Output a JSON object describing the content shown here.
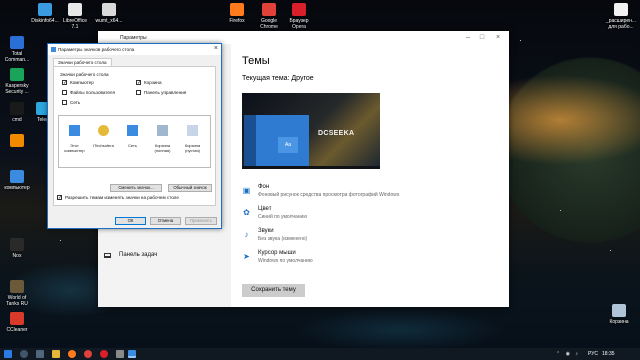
{
  "desktop": {
    "icons": [
      {
        "label": "Diskinfo64...",
        "icon": "diskinfo-icon",
        "color": "#3b9be0"
      },
      {
        "label": "LibreOffice\n7.1",
        "icon": "libreoffice-icon",
        "color": "#e8e8e8"
      },
      {
        "label": "wumt_x64...",
        "icon": "wumt-icon",
        "color": "#d9d9d9"
      },
      {
        "label": "Firefox",
        "icon": "firefox-icon",
        "color": "#ff7b1c"
      },
      {
        "label": "Google\nChrome",
        "icon": "chrome-icon",
        "color": "#e0423a"
      },
      {
        "label": "Браузер\nOpera",
        "icon": "opera-icon",
        "color": "#d81f2a"
      },
      {
        "label": "_расширен...\nдля рабо...",
        "icon": "document-icon",
        "color": "#f2f2f2"
      },
      {
        "label": "Total\nComman...",
        "icon": "total-commander-icon",
        "color": "#2a6fd6"
      },
      {
        "label": "Kaspersky\nSecurity ...",
        "icon": "kaspersky-icon",
        "color": "#1aa35a"
      },
      {
        "label": "cmd",
        "icon": "cmd-icon",
        "color": "#1a1a1a"
      },
      {
        "label": "Teleg",
        "icon": "telegram-icon",
        "color": "#2ea6de"
      },
      {
        "label": "",
        "icon": "vlc-icon",
        "color": "#f08a00"
      },
      {
        "label": "компьютер",
        "icon": "computer-icon",
        "color": "#3b8be0"
      },
      {
        "label": "Nox",
        "icon": "nox-icon",
        "color": "#2a2a2a"
      },
      {
        "label": "World of\nTanks RU",
        "icon": "world-of-tanks-icon",
        "color": "#6b5a3a"
      },
      {
        "label": "CCleaner",
        "icon": "ccleaner-icon",
        "color": "#d93a2a"
      },
      {
        "label": "Корзина",
        "icon": "recycle-bin-icon",
        "color": "#b0c4d8"
      }
    ]
  },
  "settings_window": {
    "title": "Параметры",
    "heading": "Темы",
    "current_theme": "Текущая тема: Другое",
    "preview_watermark": "DCSEEKA",
    "preview_tile": "Aa",
    "nav_taskbar": "Панель задач",
    "options": [
      {
        "title": "Фон",
        "subtitle": "Фоновый рисунок средства просмотра фотографий Windows",
        "icon": "background-icon"
      },
      {
        "title": "Цвет",
        "subtitle": "Синий по умолчанию",
        "icon": "palette-icon"
      },
      {
        "title": "Звуки",
        "subtitle": "Без звука (изменено)",
        "icon": "sound-icon"
      },
      {
        "title": "Курсор мыши",
        "subtitle": "Windows по умолчанию",
        "icon": "cursor-icon"
      }
    ],
    "save_theme": "Сохранить тему"
  },
  "desktop_icons_dialog": {
    "title": "Параметры значков рабочего стола",
    "tab": "Значки рабочего стола",
    "group_label": "Значки рабочего стола",
    "checkboxes": [
      {
        "label": "Компьютер",
        "checked": true
      },
      {
        "label": "Корзина",
        "checked": true
      },
      {
        "label": "Файлы пользователя",
        "checked": false
      },
      {
        "label": "Панель управления",
        "checked": false
      },
      {
        "label": "Сеть",
        "checked": false
      }
    ],
    "icons": [
      {
        "label": "Этот\nкомпьютер",
        "icon": "this-pc-icon",
        "color": "#3b8be0"
      },
      {
        "label": "ITechsofera",
        "icon": "user-folder-icon",
        "color": "#e5b93a"
      },
      {
        "label": "Сеть",
        "icon": "network-icon",
        "color": "#3b8be0"
      },
      {
        "label": "Корзина\n(полная)",
        "icon": "recycle-bin-full-icon",
        "color": "#9fb8d0"
      },
      {
        "label": "Корзина\n(пустая)",
        "icon": "recycle-bin-empty-icon",
        "color": "#c6d6e6"
      }
    ],
    "change_icon": "Сменить значок...",
    "default_icon": "Обычный значок",
    "allow_themes": "Разрешить темам изменять значки на рабочем столе",
    "allow_themes_checked": true,
    "ok": "ОК",
    "cancel": "Отмена",
    "apply": "Применить"
  },
  "taskbar": {
    "lang": "РУС",
    "time": "18:35"
  }
}
